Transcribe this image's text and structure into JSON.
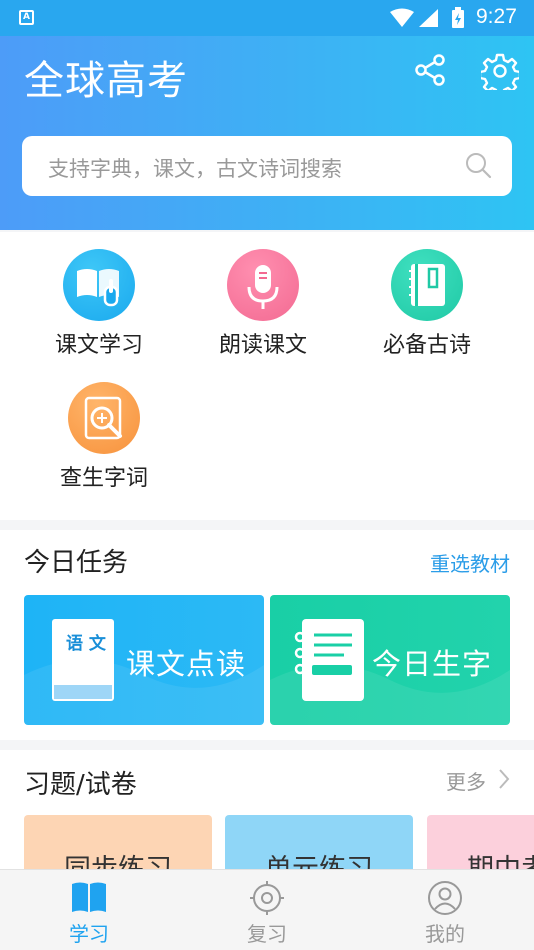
{
  "status_bar": {
    "app_badge": "A",
    "time": "9:27"
  },
  "header": {
    "title": "全球高考",
    "search_placeholder": "支持字典，课文，古文诗词搜索"
  },
  "features": [
    {
      "label": "课文学习",
      "icon": "book-touch-icon"
    },
    {
      "label": "朗读课文",
      "icon": "microphone-icon"
    },
    {
      "label": "必备古诗",
      "icon": "notebook-icon"
    },
    {
      "label": "查生字词",
      "icon": "magnify-character-icon"
    }
  ],
  "today_task": {
    "title": "今日任务",
    "reselect": "重选教材",
    "cards": [
      {
        "label": "课文点读",
        "book_text": "语 文"
      },
      {
        "label": "今日生字"
      }
    ]
  },
  "exercises": {
    "title": "习题/试卷",
    "more": "更多",
    "cards": [
      {
        "label": "同步练习"
      },
      {
        "label": "单元练习"
      },
      {
        "label": "期中考"
      }
    ]
  },
  "bottom_nav": [
    {
      "label": "学习",
      "active": true
    },
    {
      "label": "复习",
      "active": false
    },
    {
      "label": "我的",
      "active": false
    }
  ],
  "colors": {
    "accent": "#1fa3f0",
    "header_start": "#4d9cf8",
    "header_end": "#2ec4f3",
    "task_blue": "#1eb4f6",
    "task_green": "#19cfa6"
  }
}
